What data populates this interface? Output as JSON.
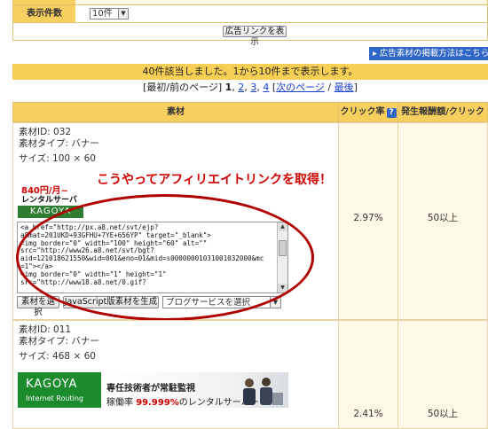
{
  "filter": {
    "count_label": "表示件数",
    "count_value": "10件",
    "show_link_button": "広告リンクを表示"
  },
  "howto_link": "広告素材の掲載方法はこちら",
  "summary": "40件該当しました。1から10件まで表示します。",
  "pager": {
    "first_prev": "[最初/前のページ]",
    "current": "1",
    "pages": [
      "2",
      "3",
      "4"
    ],
    "next": "次のページ",
    "last": "最後",
    "sep": "/"
  },
  "table": {
    "headers": [
      "素材",
      "クリック率",
      "発生報酬額/クリック"
    ],
    "help_icon": "?"
  },
  "row1": {
    "id": "素材ID: 032",
    "type": "素材タイプ: バナー",
    "size": "サイズ: 100 × 60",
    "banner_line1": "840円/月~",
    "banner_line2": "レンタルサーバー",
    "banner_brand": "KAGOYA",
    "code": "<a href=\"http://px.a8.net/svt/ejp?\na8mat=201UKD+93GFHU+7YE+656YP\" target=\"_blank\">\n<img border=\"0\" width=\"100\" height=\"60\" alt=\"\"\nsrc=\"http://www26.a8.net/svt/bgt?\naid=121018621550&wid=001&eno=01&mid=s00000001031001032000&mc\n=1\"></a>\n<img border=\"0\" width=\"1\" height=\"1\"\nsrc=\"http://www18.a8.net/0.gif?",
    "btn_material": "素材を選択",
    "btn_js": "JavaScript版素材を生成",
    "blog_select": "ブログサービスを選択",
    "click_rate": "2.97%",
    "reward": "50以上"
  },
  "annotation": "こうやってアフィリエイトリンクを取得！",
  "row2": {
    "id": "素材ID: 011",
    "type": "素材タイプ: バナー",
    "size": "サイズ: 468 × 60",
    "banner_brand": "KAGOYA",
    "banner_sub": "Internet Routing",
    "tagline": "専任技術者が常駐監視",
    "rate_prefix": "稼働率",
    "rate_value": "99.999%",
    "rate_suffix": "のレンタルサーバー",
    "click_rate": "2.41%",
    "reward": "50以上"
  }
}
